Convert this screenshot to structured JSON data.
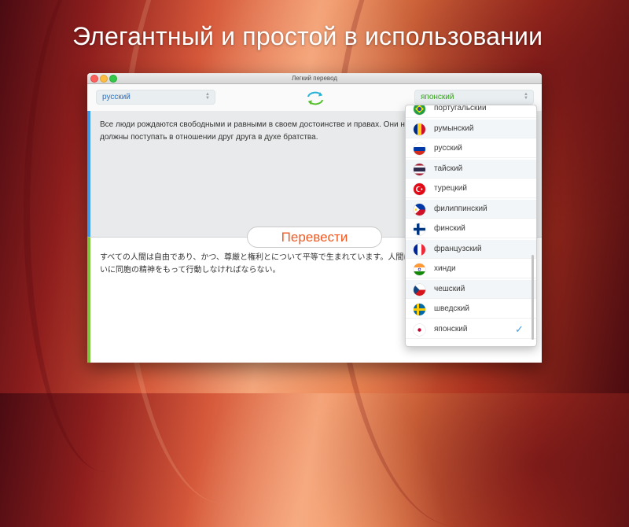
{
  "headline": "Элегантный и простой в использовании",
  "window": {
    "title": "Легкий перевод"
  },
  "toolbar": {
    "source_language": "русский",
    "target_language": "японский",
    "select_arrows": "▲\n▼",
    "swap_icon": "swap-arrows-icon"
  },
  "source_text": "Все люди рождаются свободными и равными в своем достоинстве и правах. Они наделены разумом и совестью и должны поступать в отношении друг друга в духе братства.",
  "translated_text": "すべての人間は自由であり、かつ、尊厳と権利とについて平等で生まれています。人間は理性と良心とを授けられており、互いに同胞の精神をもって行動しなければならない。",
  "translate_button": "Перевести",
  "dropdown": {
    "options": [
      {
        "label": "португальский",
        "flag": "brazil-flag-icon"
      },
      {
        "label": "румынский",
        "flag": "romania-flag-icon"
      },
      {
        "label": "русский",
        "flag": "russia-flag-icon"
      },
      {
        "label": "тайский",
        "flag": "thailand-flag-icon"
      },
      {
        "label": "турецкий",
        "flag": "turkey-flag-icon"
      },
      {
        "label": "филиппинский",
        "flag": "philippines-flag-icon"
      },
      {
        "label": "финский",
        "flag": "finland-flag-icon"
      },
      {
        "label": "французский",
        "flag": "france-flag-icon"
      },
      {
        "label": "хинди",
        "flag": "india-flag-icon"
      },
      {
        "label": "чешский",
        "flag": "czech-flag-icon"
      },
      {
        "label": "шведский",
        "flag": "sweden-flag-icon"
      },
      {
        "label": "японский",
        "flag": "japan-flag-icon",
        "selected": true
      }
    ],
    "check_mark": "✓"
  },
  "colors": {
    "source_accent": "#3d9be9",
    "target_accent": "#7ac53d",
    "translate_button_text": "#f05a23"
  }
}
